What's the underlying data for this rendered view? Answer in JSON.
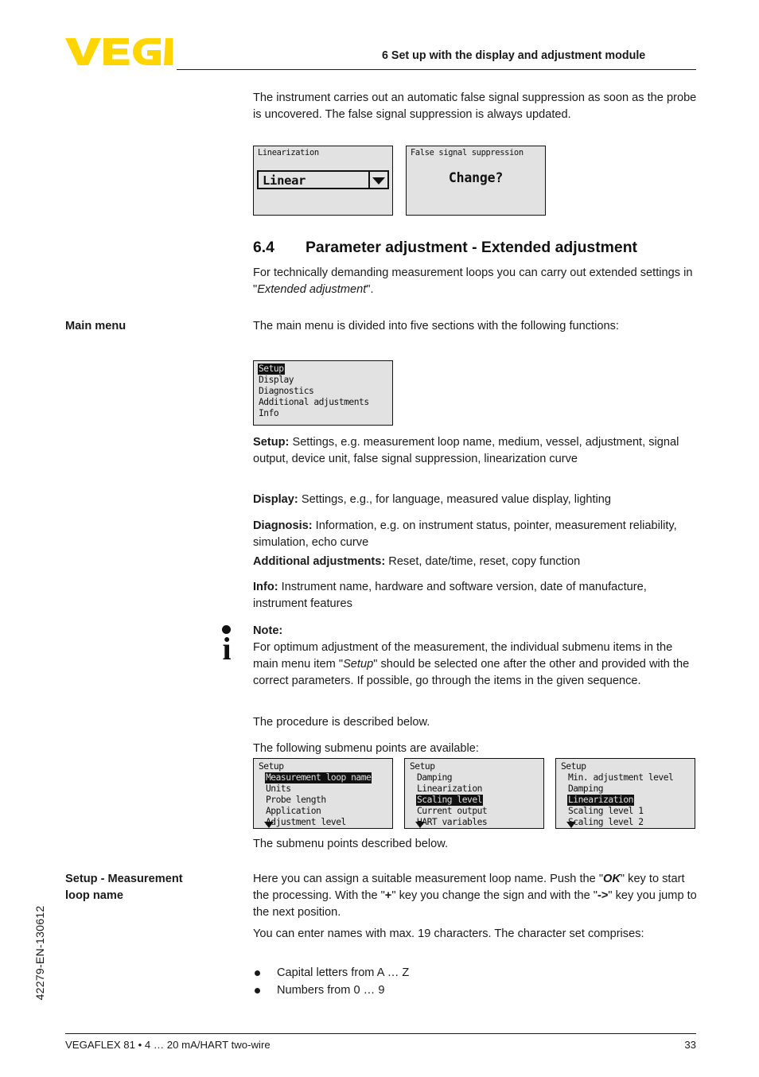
{
  "header": {
    "logo_text": "VEGA",
    "logo_color": "#FFD500",
    "title": "6 Set up with the display and adjustment module"
  },
  "intro": {
    "paragraph": "The instrument carries out an automatic false signal suppression as soon as the probe is uncovered. The false signal suppression is always updated."
  },
  "lcd_linearization": {
    "title": "Linearization",
    "value": "Linear",
    "arrow": "chevron-down-icon"
  },
  "lcd_false_signal": {
    "title": "False signal suppression",
    "prompt": "Change?"
  },
  "section": {
    "number": "6.4",
    "title": "Parameter adjustment - Extended adjustment",
    "intro_1": "For technically demanding measurement loops you can carry out",
    "intro_2_pre": "extended settings in \"",
    "intro_2_em": "Extended adjustment",
    "intro_2_post": "\"."
  },
  "main_menu": {
    "margin_label": "Main menu",
    "paragraph": "The main menu is divided into five sections with the following functions:",
    "lcd_items": [
      {
        "label": "Setup",
        "selected": true
      },
      {
        "label": "Display",
        "selected": false
      },
      {
        "label": "Diagnostics",
        "selected": false
      },
      {
        "label": "Additional adjustments",
        "selected": false
      },
      {
        "label": "Info",
        "selected": false
      }
    ],
    "descriptions": [
      {
        "term": "Setup:",
        "text": " Settings, e.g. measurement loop name, medium, vessel, adjustment, signal output, device unit, false signal suppression, linearization curve"
      },
      {
        "term": "Display:",
        "text": " Settings, e.g., for language, measured value display, lighting"
      },
      {
        "term": "Diagnosis:",
        "text": " Information, e.g. on instrument status, pointer, measurement reliability, simulation, echo curve"
      },
      {
        "term": "Additional adjustments:",
        "text": " Reset, date/time, reset, copy function"
      },
      {
        "term": "Info:",
        "text": " Instrument name, hardware and software version, date of manufacture, instrument features"
      }
    ]
  },
  "note": {
    "icon": "info-icon",
    "heading": "Note:",
    "body_1": "For optimum adjustment of the measurement, the individual submenu",
    "body_2_pre": "items in the main menu item \"",
    "body_2_em": "Setup",
    "body_2_post": "\" should be selected one after",
    "body_3": "the other and provided with the correct parameters. If possible, go",
    "body_4": "through the items in the given sequence."
  },
  "procedure": {
    "line_1": "The procedure is described below.",
    "line_2": "The following submenu points are available:",
    "caption": "The submenu points described below."
  },
  "submenus": [
    {
      "header": "Setup",
      "items": [
        {
          "label": "Measurement loop name",
          "selected": true
        },
        {
          "label": "Units",
          "selected": false
        },
        {
          "label": "Probe length",
          "selected": false
        },
        {
          "label": "Application",
          "selected": false
        },
        {
          "label": "Adjustment level",
          "selected": false
        }
      ],
      "more": true
    },
    {
      "header": "Setup",
      "items": [
        {
          "label": "Damping",
          "selected": false
        },
        {
          "label": "Linearization",
          "selected": false
        },
        {
          "label": "Scaling level",
          "selected": true
        },
        {
          "label": "Current output",
          "selected": false
        },
        {
          "label": "HART variables",
          "selected": false
        }
      ],
      "more": true
    },
    {
      "header": "Setup",
      "items": [
        {
          "label": "Min. adjustment level",
          "selected": false
        },
        {
          "label": "Damping",
          "selected": false
        },
        {
          "label": "Linearization",
          "selected": true
        },
        {
          "label": "Scaling level 1",
          "selected": false
        },
        {
          "label": "Scaling level 2",
          "selected": false
        }
      ],
      "more": true
    }
  ],
  "setup_loop": {
    "margin_label_1": "Setup - Measurement",
    "margin_label_2": "loop name",
    "p1_a": "Here you can assign a suitable measurement loop name. Push the",
    "p1_b_pre": "\"",
    "p1_b_em": "OK",
    "p1_b_post": "\" key to start the processing. With the \"",
    "p1_b_em2": "+",
    "p1_b_post2": "\" key you change the sign",
    "p1_c_pre": "and with the \"",
    "p1_c_em": "->",
    "p1_c_post": "\" key you jump to the next position.",
    "p2": "You can enter names with max. 19 characters. The character set comprises:",
    "bullets": [
      "Capital letters from A … Z",
      "Numbers from 0 … 9"
    ]
  },
  "side_code": "42279-EN-130612",
  "footer": {
    "left": "VEGAFLEX 81 • 4 … 20 mA/HART two-wire",
    "page": "33"
  }
}
